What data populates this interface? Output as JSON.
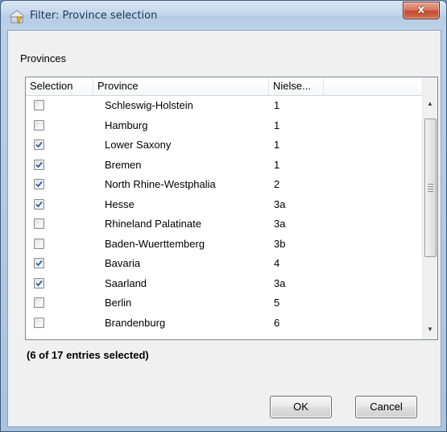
{
  "window": {
    "title": "Filter: Province selection",
    "close_glyph": "x"
  },
  "group_label": "Provinces",
  "table": {
    "columns": [
      "Selection",
      "Province",
      "Nielse..."
    ],
    "rows": [
      {
        "checked": false,
        "province": "Schleswig-Holstein",
        "nielsen": "1"
      },
      {
        "checked": false,
        "province": "Hamburg",
        "nielsen": "1"
      },
      {
        "checked": true,
        "province": "Lower Saxony",
        "nielsen": "1"
      },
      {
        "checked": true,
        "province": "Bremen",
        "nielsen": "1"
      },
      {
        "checked": true,
        "province": "North Rhine-Westphalia",
        "nielsen": "2"
      },
      {
        "checked": true,
        "province": "Hesse",
        "nielsen": "3a"
      },
      {
        "checked": false,
        "province": "Rhineland Palatinate",
        "nielsen": "3a"
      },
      {
        "checked": false,
        "province": "Baden-Wuerttemberg",
        "nielsen": "3b"
      },
      {
        "checked": true,
        "province": "Bavaria",
        "nielsen": "4"
      },
      {
        "checked": true,
        "province": "Saarland",
        "nielsen": "3a"
      },
      {
        "checked": false,
        "province": "Berlin",
        "nielsen": "5"
      },
      {
        "checked": false,
        "province": "Brandenburg",
        "nielsen": "6"
      }
    ]
  },
  "status_text": "(6 of 17 entries selected)",
  "buttons": {
    "ok": "OK",
    "cancel": "Cancel"
  },
  "icons": {
    "title": "filter-icon",
    "scroll_up": "scroll-up-arrow-icon",
    "scroll_down": "scroll-down-arrow-icon"
  },
  "colors": {
    "checkmark": "#2a5fa8",
    "close_button": "#c74b2f",
    "title_text": "#1e395b"
  }
}
